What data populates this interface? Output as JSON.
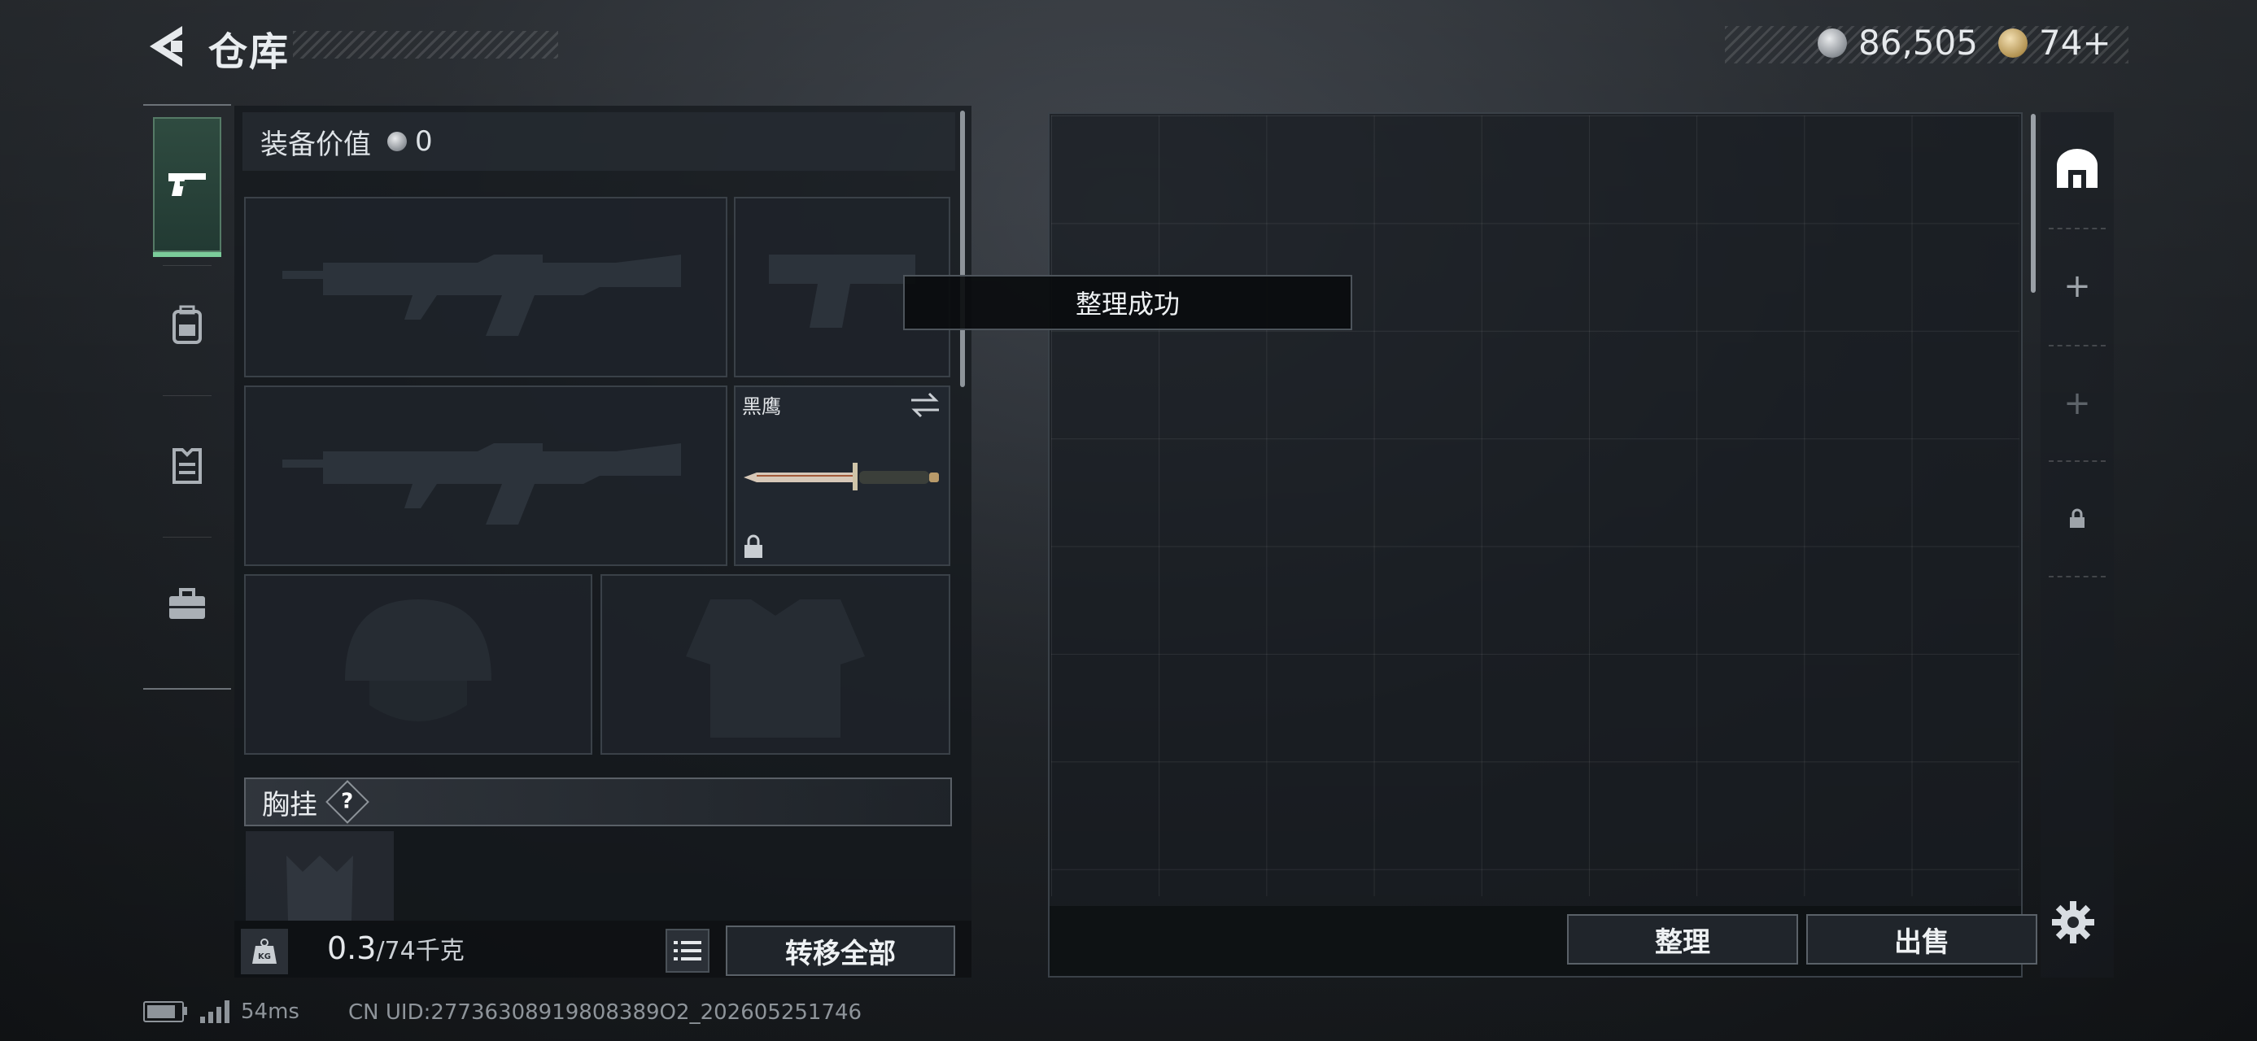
{
  "header": {
    "title": "仓库",
    "currency_silver": "86,505",
    "currency_gold": "74+"
  },
  "left_nav": {
    "items": [
      "pistol-icon",
      "backpack-icon",
      "armor-vest-icon",
      "toolbox-icon"
    ],
    "active_index": 0
  },
  "equipment": {
    "value_label": "装备价值",
    "value": "0",
    "knife_name": "黑鹰",
    "chest_rig_label": "胸挂",
    "help_mark": "?",
    "weight_current": "0.3",
    "weight_capacity": "/74千克",
    "transfer_all_label": "转移全部"
  },
  "toast": {
    "message": "整理成功"
  },
  "storage": {
    "sort_label": "整理",
    "sell_label": "出售",
    "side_tabs": [
      "home-storage-icon",
      "+",
      "+",
      "lock-icon"
    ]
  },
  "status_bar": {
    "ping": "54ms",
    "uid": "CN UID:27736308919808389O2_202605251746"
  },
  "colors": {
    "accent_green": "#7bcc9a",
    "panel_bg": "#1e232a",
    "border": "#5a6168"
  }
}
